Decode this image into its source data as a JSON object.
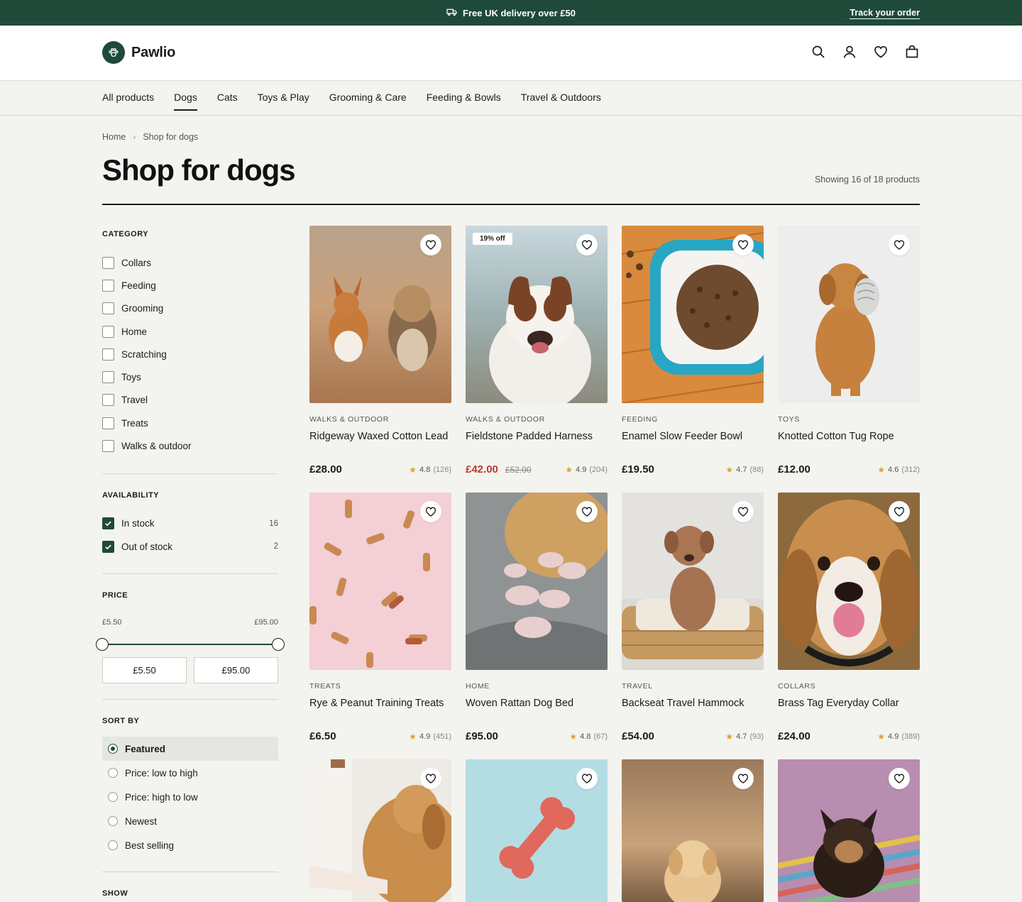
{
  "announcement": {
    "text": "Free UK delivery over £50",
    "link": "Track your order"
  },
  "brand": {
    "name": "Pawlio",
    "color": "#1f4a3a"
  },
  "header_icons": [
    "search-icon",
    "account-icon",
    "heart-icon",
    "bag-icon"
  ],
  "nav": [
    "All products",
    "Dogs",
    "Cats",
    "Toys & Play",
    "Grooming & Care",
    "Feeding & Bowls",
    "Travel & Outdoors"
  ],
  "nav_active": "Dogs",
  "breadcrumb": [
    "Home",
    "Shop for dogs"
  ],
  "page": {
    "title": "Shop for dogs",
    "showing": "Showing 16 of 18 products"
  },
  "filters": {
    "category": {
      "title": "CATEGORY",
      "items": [
        "Collars",
        "Feeding",
        "Grooming",
        "Home",
        "Scratching",
        "Toys",
        "Travel",
        "Treats",
        "Walks & outdoor"
      ]
    },
    "availability": {
      "title": "AVAILABILITY",
      "items": [
        {
          "label": "In stock",
          "count": "16",
          "checked": true
        },
        {
          "label": "Out of stock",
          "count": "2",
          "checked": true
        }
      ]
    },
    "price": {
      "title": "PRICE",
      "min_label": "£5.50",
      "max_label": "£95.00",
      "min_value": "£5.50",
      "max_value": "£95.00"
    },
    "sort": {
      "title": "SORT BY",
      "options": [
        "Featured",
        "Price: low to high",
        "Price: high to low",
        "Newest",
        "Best selling"
      ],
      "selected": "Featured"
    },
    "show": {
      "title": "SHOW"
    }
  },
  "products": [
    {
      "category": "WALKS & OUTDOOR",
      "title": "Ridgeway Waxed Cotton Lead",
      "price": "£28.00",
      "rating": "4.8",
      "reviews": "(126)"
    },
    {
      "category": "WALKS & OUTDOOR",
      "title": "Fieldstone Padded Harness",
      "price": "£42.00",
      "was": "£52.00",
      "badge": "19% off",
      "rating": "4.9",
      "reviews": "(204)"
    },
    {
      "category": "FEEDING",
      "title": "Enamel Slow Feeder Bowl",
      "price": "£19.50",
      "rating": "4.7",
      "reviews": "(88)"
    },
    {
      "category": "TOYS",
      "title": "Knotted Cotton Tug Rope",
      "price": "£12.00",
      "rating": "4.6",
      "reviews": "(312)"
    },
    {
      "category": "TREATS",
      "title": "Rye & Peanut Training Treats",
      "price": "£6.50",
      "rating": "4.9",
      "reviews": "(451)"
    },
    {
      "category": "HOME",
      "title": "Woven Rattan Dog Bed",
      "price": "£95.00",
      "rating": "4.8",
      "reviews": "(67)"
    },
    {
      "category": "TRAVEL",
      "title": "Backseat Travel Hammock",
      "price": "£54.00",
      "rating": "4.7",
      "reviews": "(93)"
    },
    {
      "category": "COLLARS",
      "title": "Brass Tag Everyday Collar",
      "price": "£24.00",
      "rating": "4.9",
      "reviews": "(389)"
    },
    {
      "category": "",
      "title": "",
      "price": "",
      "rating": "",
      "reviews": ""
    },
    {
      "category": "",
      "title": "",
      "price": "",
      "rating": "",
      "reviews": ""
    },
    {
      "category": "",
      "title": "",
      "price": "",
      "rating": "",
      "reviews": ""
    },
    {
      "category": "",
      "title": "",
      "price": "",
      "rating": "",
      "reviews": ""
    }
  ]
}
